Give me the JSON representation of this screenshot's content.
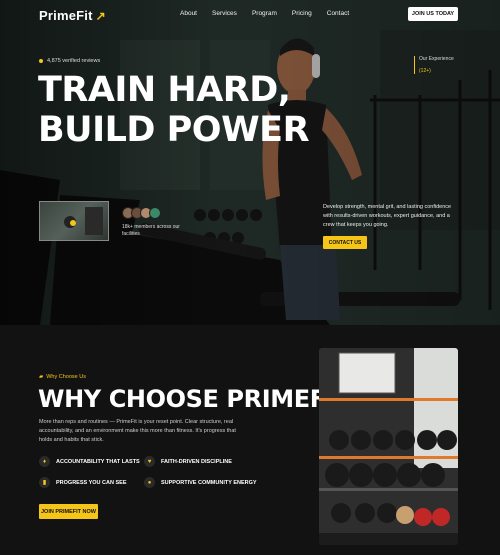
{
  "nav": {
    "logo": "PrimeFit",
    "links": [
      "About",
      "Services",
      "Program",
      "Pricing",
      "Contact"
    ],
    "cta": "JOIN US TODAY"
  },
  "hero": {
    "reviews": "4,875 verified reviews",
    "headline_line1": "TRAIN HARD,",
    "headline_line2": "BUILD POWER",
    "experience_label": "Our Experience",
    "experience_value": "(12+)",
    "members_text": "18k+ members across our facilities",
    "description": "Develop strength, mental grit, and lasting confidence with results-driven workouts, expert guidance, and a crew that keeps you going.",
    "cta": "CONTACT US"
  },
  "why": {
    "tag": "Why Choose Us",
    "title": "WHY CHOOSE PRIMEFIT?",
    "description": "More than reps and routines — PrimeFit is your reset point. Clear structure, real accountability, and an environment make this more than fitness. It's progress that holds and habits that stick.",
    "features": [
      "ACCOUNTABILITY THAT LASTS",
      "FAITH-DRIVEN DISCIPLINE",
      "PROGRESS YOU CAN SEE",
      "SUPPORTIVE COMMUNITY ENERGY"
    ],
    "cta": "JOIN PRIMEFIT NOW"
  },
  "colors": {
    "accent": "#f5c518",
    "background": "#121212"
  }
}
